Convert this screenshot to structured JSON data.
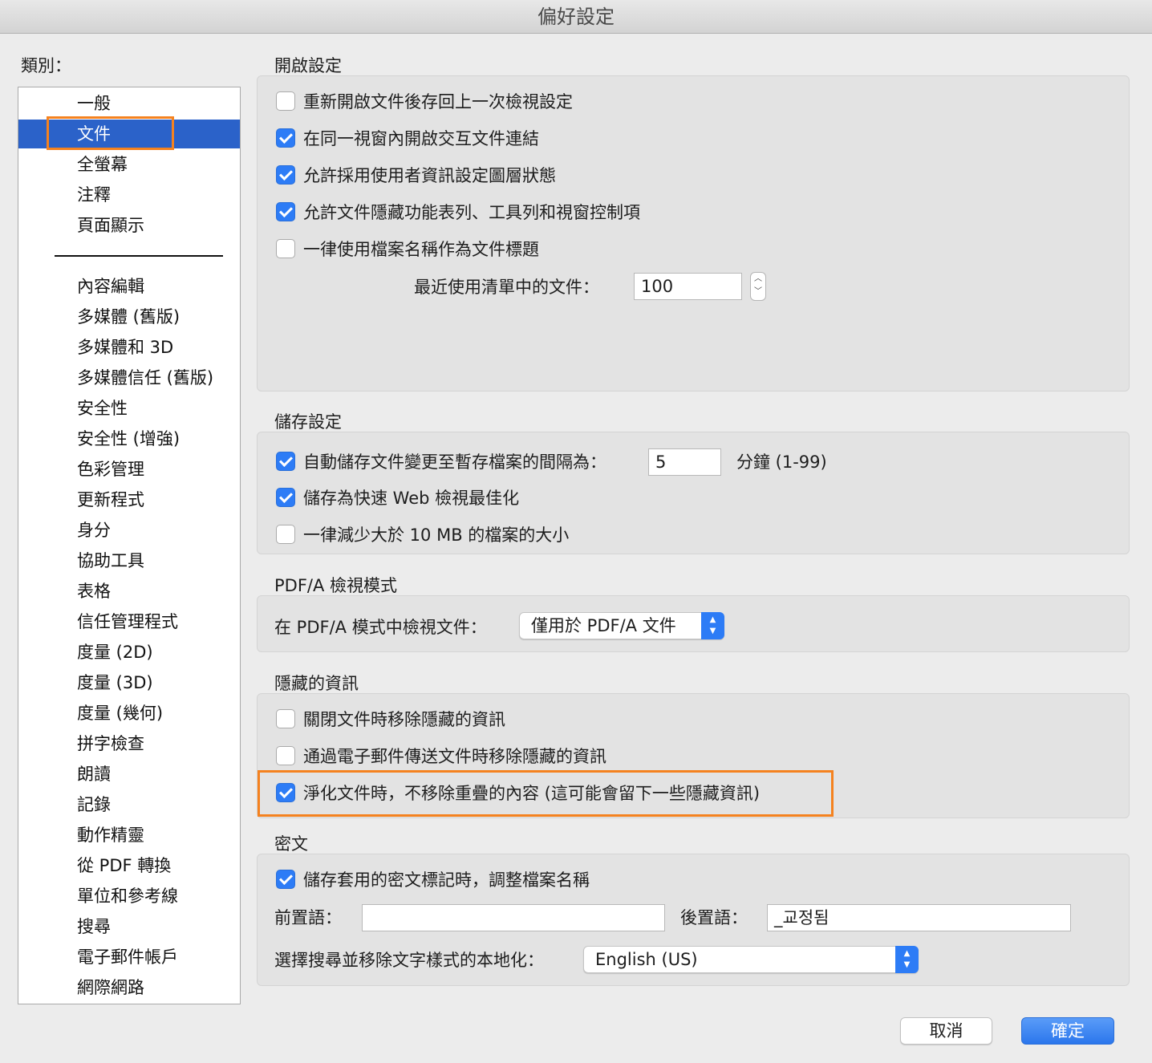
{
  "window": {
    "title": "偏好設定"
  },
  "sidebar": {
    "label": "類別：",
    "items_top": [
      {
        "label": "一般",
        "selected": false
      },
      {
        "label": "文件",
        "selected": true
      },
      {
        "label": "全螢幕",
        "selected": false
      },
      {
        "label": "注釋",
        "selected": false
      },
      {
        "label": "頁面顯示",
        "selected": false
      }
    ],
    "items_bottom": [
      "內容編輯",
      "多媒體 (舊版)",
      "多媒體和 3D",
      "多媒體信任 (舊版)",
      "安全性",
      "安全性 (增強)",
      "色彩管理",
      "更新程式",
      "身分",
      "協助工具",
      "表格",
      "信任管理程式",
      "度量 (2D)",
      "度量 (3D)",
      "度量 (幾何)",
      "拼字檢查",
      "朗讀",
      "記錄",
      "動作精靈",
      "從 PDF 轉換",
      "單位和參考線",
      "搜尋",
      "電子郵件帳戶",
      "網際網路"
    ]
  },
  "open_settings": {
    "title": "開啟設定",
    "options": [
      {
        "label": "重新開啟文件後存回上一次檢視設定",
        "checked": false
      },
      {
        "label": "在同一視窗內開啟交互文件連結",
        "checked": true
      },
      {
        "label": "允許採用使用者資訊設定圖層狀態",
        "checked": true
      },
      {
        "label": "允許文件隱藏功能表列、工具列和視窗控制項",
        "checked": true
      },
      {
        "label": "一律使用檔案名稱作為文件標題",
        "checked": false
      }
    ],
    "recent_label": "最近使用清單中的文件：",
    "recent_value": "100"
  },
  "save_settings": {
    "title": "儲存設定",
    "autosave_label": "自動儲存文件變更至暫存檔案的間隔為：",
    "autosave_checked": true,
    "autosave_value": "5",
    "autosave_unit": "分鐘 (1-99)",
    "options": [
      {
        "label": "儲存為快速 Web 檢視最佳化",
        "checked": true
      },
      {
        "label": "一律減少大於 10 MB 的檔案的大小",
        "checked": false
      }
    ]
  },
  "pdfa": {
    "title": "PDF/A 檢視模式",
    "label": "在 PDF/A 模式中檢視文件：",
    "selected": "僅用於 PDF/A 文件"
  },
  "hidden_info": {
    "title": "隱藏的資訊",
    "options": [
      {
        "label": "關閉文件時移除隱藏的資訊",
        "checked": false
      },
      {
        "label": "通過電子郵件傳送文件時移除隱藏的資訊",
        "checked": false
      },
      {
        "label": "淨化文件時，不移除重疊的內容 (這可能會留下一些隱藏資訊)",
        "checked": true
      }
    ]
  },
  "redaction": {
    "title": "密文",
    "option": {
      "label": "儲存套用的密文標記時，調整檔案名稱",
      "checked": true
    },
    "prefix_label": "前置語：",
    "prefix_value": "",
    "suffix_label": "後置語：",
    "suffix_value": "_교정됨",
    "locale_label": "選擇搜尋並移除文字樣式的本地化：",
    "locale_value": "English (US)"
  },
  "buttons": {
    "cancel": "取消",
    "ok": "確定"
  },
  "colors": {
    "accent": "#2b62c9",
    "highlight": "#f5821f",
    "checkbox": "#2d7cf6"
  }
}
